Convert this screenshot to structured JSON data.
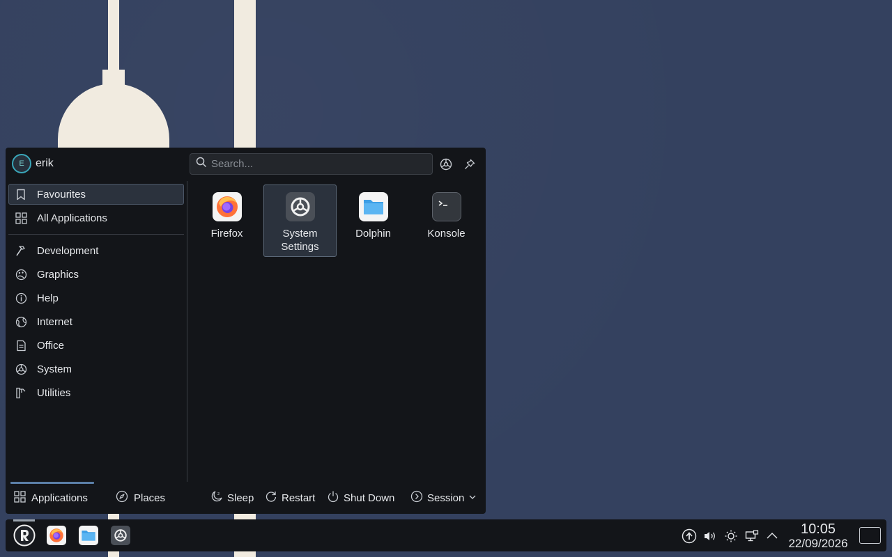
{
  "launcher": {
    "user": {
      "initial": "E",
      "name": "erik"
    },
    "search": {
      "placeholder": "Search..."
    },
    "categories_top": [
      {
        "label": "Favourites",
        "icon": "bookmark-icon",
        "active": true
      },
      {
        "label": "All Applications",
        "icon": "grid-icon"
      }
    ],
    "categories": [
      {
        "label": "Development",
        "icon": "hammer-icon"
      },
      {
        "label": "Graphics",
        "icon": "palette-icon"
      },
      {
        "label": "Help",
        "icon": "info-icon"
      },
      {
        "label": "Internet",
        "icon": "globe-icon"
      },
      {
        "label": "Office",
        "icon": "document-icon"
      },
      {
        "label": "System",
        "icon": "system-gear-icon"
      },
      {
        "label": "Utilities",
        "icon": "utilities-icon"
      }
    ],
    "apps": [
      {
        "label": "Firefox",
        "icon": "firefox-icon"
      },
      {
        "label": "System Settings",
        "icon": "system-settings-icon",
        "selected": true
      },
      {
        "label": "Dolphin",
        "icon": "dolphin-folder-icon"
      },
      {
        "label": "Konsole",
        "icon": "konsole-terminal-icon"
      }
    ],
    "footer": {
      "tabs": {
        "applications": "Applications",
        "places": "Places"
      },
      "power": {
        "sleep": "Sleep",
        "restart": "Restart",
        "shutdown": "Shut Down",
        "session": "Session"
      }
    }
  },
  "taskbar": {
    "clock": {
      "time": "10:05",
      "date": "22/09/2026"
    }
  },
  "colors": {
    "accent": "#3aa6b9",
    "panel": "#131519",
    "desktop": "#34415f",
    "wallpaper_shape": "#f1ebe0"
  }
}
